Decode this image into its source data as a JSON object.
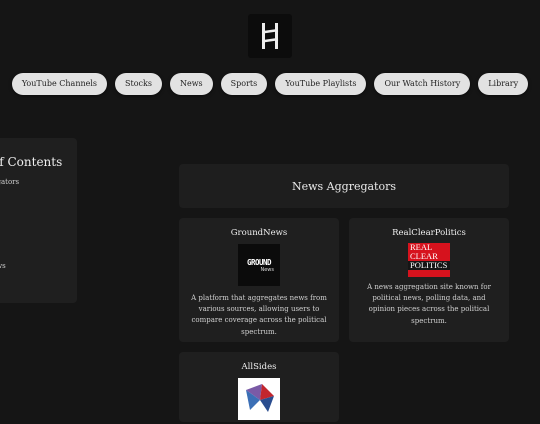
{
  "nav": {
    "items": [
      "YouTube Channels",
      "Stocks",
      "News",
      "Sports",
      "YouTube Playlists",
      "Our Watch History",
      "Library"
    ]
  },
  "toc": {
    "title": "of Contents",
    "items": [
      "ggators",
      "s",
      "",
      "ews",
      "s"
    ]
  },
  "section": {
    "title": "News Aggregators"
  },
  "cards": [
    {
      "title": "GroundNews",
      "logo_text_top": "GROUND",
      "logo_text_bottom": "News",
      "description": "A platform that aggregates news from various sources, allowing users to compare coverage across the political spectrum."
    },
    {
      "title": "RealClearPolitics",
      "logo_text": [
        "REAL",
        "CLEAR",
        "POLITICS"
      ],
      "description": "A news aggregation site known for political news, polling data, and opinion pieces across the political spectrum."
    },
    {
      "title": "AllSides"
    }
  ],
  "colors": {
    "background": "#151515",
    "card": "#1f1f1f",
    "pill": "#e2e2e2",
    "rcp_red": "#d6121d"
  }
}
